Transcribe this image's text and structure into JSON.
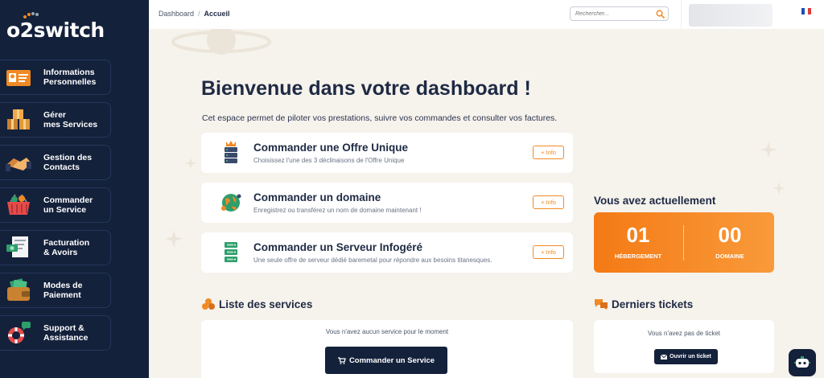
{
  "brand": {
    "name": "o2switch"
  },
  "sidebar": {
    "items": [
      {
        "label": "Informations\nPersonnelles",
        "icon": "id-card-icon"
      },
      {
        "label": "Gérer\nmes Services",
        "icon": "boxes-icon"
      },
      {
        "label": "Gestion des\nContacts",
        "icon": "handshake-icon"
      },
      {
        "label": "Commander\nun Service",
        "icon": "shopping-basket-icon"
      },
      {
        "label": "Facturation\n& Avoirs",
        "icon": "invoice-icon"
      },
      {
        "label": "Modes de\nPaiement",
        "icon": "wallet-icon"
      },
      {
        "label": "Support &\nAssistance",
        "icon": "lifebuoy-icon"
      }
    ]
  },
  "topbar": {
    "breadcrumb": {
      "root": "Dashboard",
      "separator": "/",
      "current": "Accueil"
    },
    "search_placeholder": "Rechercher...",
    "language": "FR"
  },
  "main": {
    "title": "Bienvenue dans votre dashboard !",
    "intro": "Cet espace permet de piloter vos prestations, suivre vos commandes et consulter vos factures.",
    "cards": [
      {
        "title": "Commander une Offre Unique",
        "subtitle": "Choisissez l'une des 3 déclinaisons de l'Offre Unique",
        "button": "+ Info",
        "icon": "server-crown-icon"
      },
      {
        "title": "Commander un domaine",
        "subtitle": "Enregistrez ou transférez un nom de domaine maintenant !",
        "button": "+ Info",
        "icon": "globe-icon"
      },
      {
        "title": "Commander un Serveur Infogéré",
        "subtitle": "Une seule offre de serveur dédié baremetal pour répondre aux besoins titanesques.",
        "button": "+ Info",
        "icon": "server-rack-icon"
      }
    ],
    "stats": {
      "title": "Vous avez actuellement",
      "hosting": {
        "value": "01",
        "label": "HÉBERGEMENT"
      },
      "domain": {
        "value": "00",
        "label": "DOMAINE"
      }
    },
    "services": {
      "title": "Liste des services",
      "empty": "Vous n'avez aucun service pour le moment",
      "button": "Commander un Service"
    },
    "tickets": {
      "title": "Derniers tickets",
      "empty": "Vous n'avez pas de ticket",
      "button": "Ouvrir un ticket"
    }
  },
  "colors": {
    "sidebar": "#14213b",
    "accent": "#f08a24",
    "background": "#f6f2ec"
  }
}
